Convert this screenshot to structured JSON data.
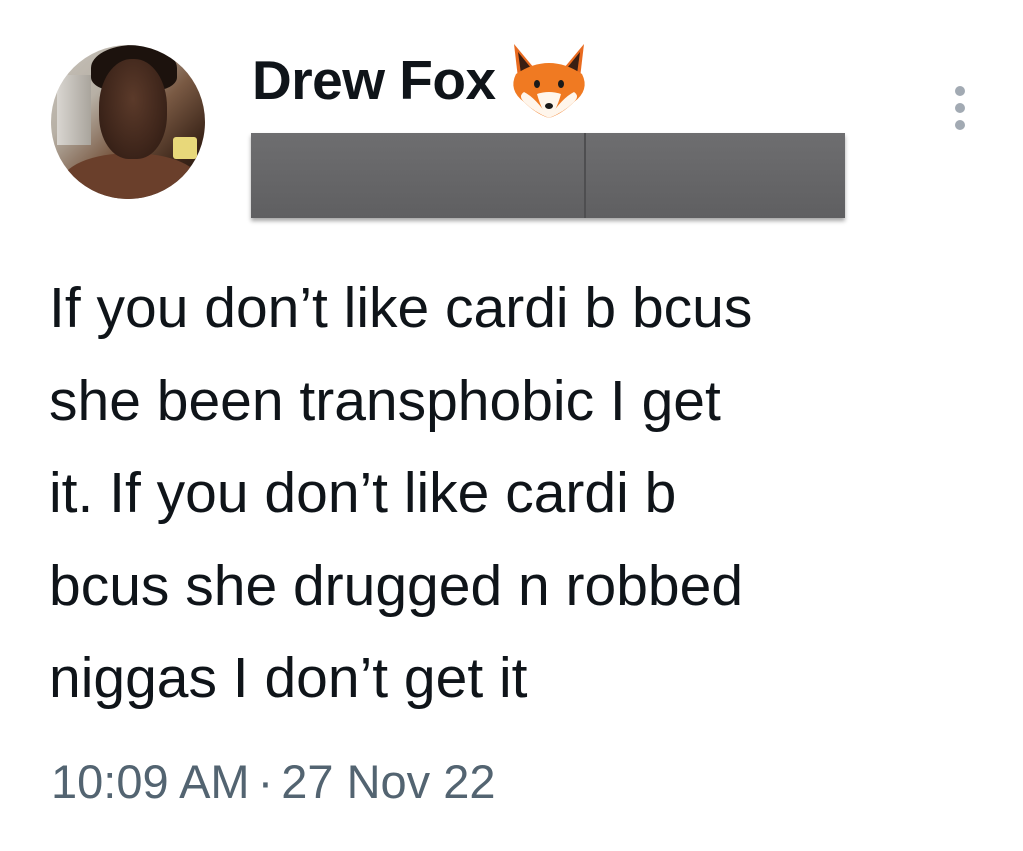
{
  "tweet": {
    "author": {
      "display_name": "Drew Fox",
      "emoji_icon": "fox-face-emoji"
    },
    "menu_icon": "more-vertical-icon",
    "body_lines": [
      "If you don’t like cardi b bcus",
      "she been transphobic I get",
      "it. If you don’t like cardi b",
      "bcus she drugged n robbed",
      "niggas I don’t get it"
    ],
    "time": "10:09 AM",
    "separator": "·",
    "date": "27 Nov 22"
  },
  "colors": {
    "text_primary": "#0f1419",
    "text_secondary": "#536471",
    "redaction": "#666668"
  }
}
